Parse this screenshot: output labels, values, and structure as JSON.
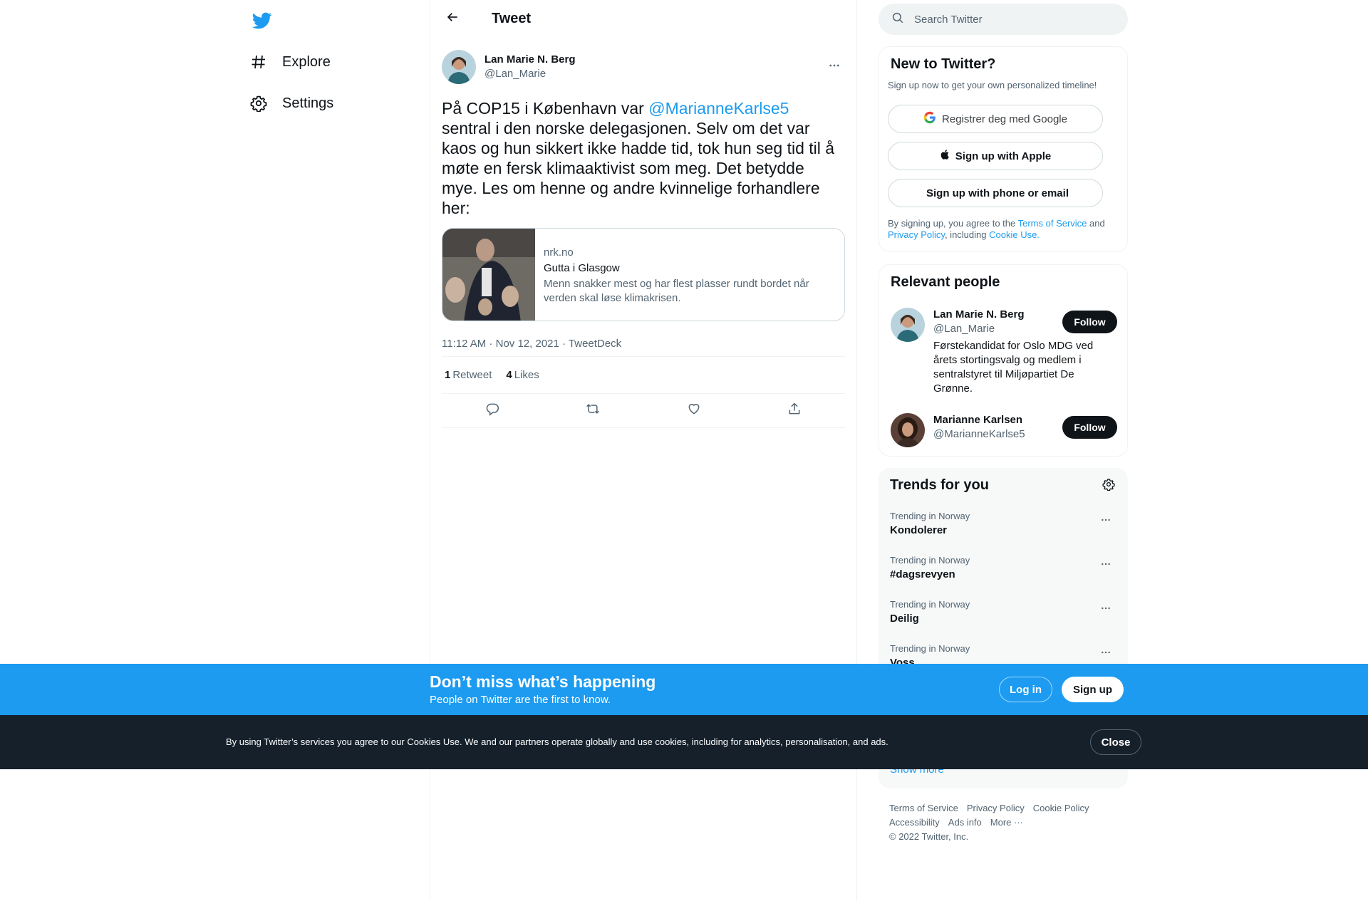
{
  "nav": {
    "logo_icon": "twitter-bird-icon",
    "brand_color": "#1d9bf0",
    "items": [
      {
        "label": "Explore",
        "icon": "hashtag-icon"
      },
      {
        "label": "Settings",
        "icon": "gear-icon"
      }
    ]
  },
  "header": {
    "title": "Tweet",
    "back_icon": "arrow-left-icon"
  },
  "tweet": {
    "author_name": "Lan Marie N. Berg",
    "author_handle": "@Lan_Marie",
    "text_before": "På COP15 i København var ",
    "mention": "@MarianneKarlse5",
    "text_after": " sentral i den norske delegasjonen. Selv om det var kaos og hun sikkert ikke hadde tid, tok hun seg tid til å møte en fersk klimaaktivist som meg. Det betydde mye. Les om henne og andre kvinnelige forhandlere her:",
    "card": {
      "domain": "nrk.no",
      "title": "Gutta i Glasgow",
      "description": "Menn snakker mest og har flest plasser rundt bordet når verden skal løse klimakrisen."
    },
    "time": "11:12 AM",
    "date": "Nov 12, 2021",
    "source": "TweetDeck",
    "sep": " · ",
    "retweets": "1",
    "retweets_label": "Retweet",
    "likes": "4",
    "likes_label": "Likes"
  },
  "search": {
    "placeholder": "Search Twitter"
  },
  "new_to_twitter": {
    "title": "New to Twitter?",
    "subtitle": "Sign up now to get your own personalized timeline!",
    "google_label": "Registrer deg med Google",
    "apple_label": "Sign up with Apple",
    "phone_label": "Sign up with phone or email",
    "legal_1": "By signing up, you agree to the ",
    "terms": "Terms of Service",
    "legal_2": " and ",
    "privacy": "Privacy Policy",
    "legal_3": ", including ",
    "cookie": "Cookie Use."
  },
  "relevant_people": {
    "title": "Relevant people",
    "people": [
      {
        "name": "Lan Marie N. Berg",
        "handle": "@Lan_Marie",
        "bio": "Førstekandidat for Oslo MDG ved årets stortingsvalg og medlem i sentralstyret til Miljøpartiet De Grønne.",
        "follow_label": "Follow"
      },
      {
        "name": "Marianne Karlsen",
        "handle": "@MarianneKarlse5",
        "bio": "",
        "follow_label": "Follow"
      }
    ]
  },
  "trends": {
    "title": "Trends for you",
    "items": [
      {
        "context": "Trending in Norway",
        "name": "Kondolerer"
      },
      {
        "context": "Trending in Norway",
        "name": "#dagsrevyen"
      },
      {
        "context": "Trending in Norway",
        "name": "Deilig"
      },
      {
        "context": "Trending in Norway",
        "name": "Voss"
      }
    ],
    "show_more": "Show more"
  },
  "footer": {
    "links": [
      "Terms of Service",
      "Privacy Policy",
      "Cookie Policy",
      "Accessibility",
      "Ads info",
      "More ···"
    ],
    "copyright": "© 2022 Twitter, Inc."
  },
  "signup_bar": {
    "heading": "Don’t miss what’s happening",
    "subheading": "People on Twitter are the first to know.",
    "login_label": "Log in",
    "signup_label": "Sign up",
    "color": "#1d9bf0"
  },
  "cookie_bar": {
    "text": "By using Twitter’s services you agree to our Cookies Use. We and our partners operate globally and use cookies, including for analytics, personalisation, and ads.",
    "close_label": "Close"
  }
}
